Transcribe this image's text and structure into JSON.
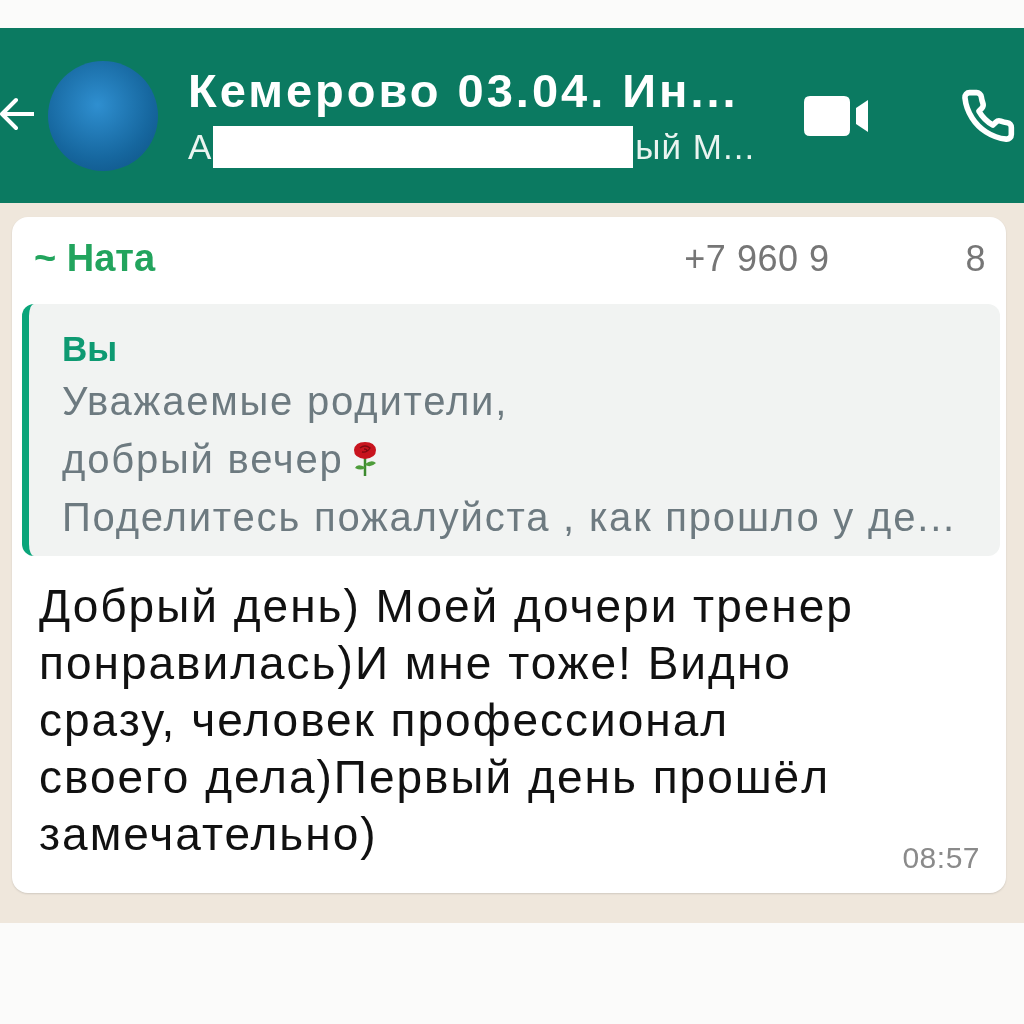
{
  "header": {
    "title": "Кемерово 03.04. Ин...",
    "subtitle": {
      "start": "А",
      "redacted": true,
      "end": "ый М..."
    }
  },
  "message": {
    "sender": {
      "name": "~ Ната",
      "phone_start": "+7 960 9",
      "phone_end": "8"
    },
    "quote": {
      "author": "Вы",
      "lines": [
        {
          "text": "Уважаемые родители,"
        },
        {
          "text": "добрый вечер",
          "emoji": true
        },
        {
          "text": "Поделитесь пожалуйста , как прошло у де..."
        }
      ]
    },
    "text": "Добрый день) Моей дочери тренер\nпонравилась)И мне тоже! Видно\nсразу, человек профессионал\nсвоего дела)Первый день прошёл\nзамечательно)",
    "time": "08:57"
  }
}
